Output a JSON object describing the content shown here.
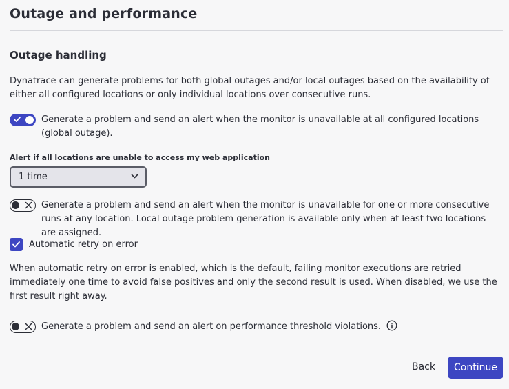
{
  "page": {
    "title": "Outage and performance"
  },
  "outage_handling": {
    "title": "Outage handling",
    "description": "Dynatrace can generate problems for both global outages and/or local outages based on the availability of either all configured locations or only individual locations over consecutive runs.",
    "global_toggle": {
      "state": "on",
      "label": "Generate a problem and send an alert when the monitor is unavailable at all configured locations (global outage)."
    },
    "alert_select": {
      "label": "Alert if all locations are unable to access my web application",
      "value": "1 time"
    },
    "local_toggle": {
      "state": "off",
      "label": "Generate a problem and send an alert when the monitor is unavailable for one or more consecutive runs at any location. Local outage problem generation is available only when at least two locations are assigned."
    },
    "retry_checkbox": {
      "checked": true,
      "label": "Automatic retry on error"
    },
    "retry_description": "When automatic retry on error is enabled, which is the default, failing monitor executions are retried immediately one time to avoid false positives and only the second result is used. When disabled, we use the first result right away.",
    "performance_toggle": {
      "state": "off",
      "label": "Generate a problem and send an alert on performance threshold violations."
    }
  },
  "footer": {
    "back_label": "Back",
    "continue_label": "Continue"
  },
  "colors": {
    "accent": "#3d46c2",
    "text": "#2b2d36",
    "background": "#f7f7f8",
    "divider": "#d6d7dc"
  },
  "icons": {
    "toggle_on": "checkmark-icon",
    "toggle_off": "x-icon",
    "checkbox": "checkmark-icon",
    "select": "chevron-down-icon",
    "info": "info-icon"
  }
}
